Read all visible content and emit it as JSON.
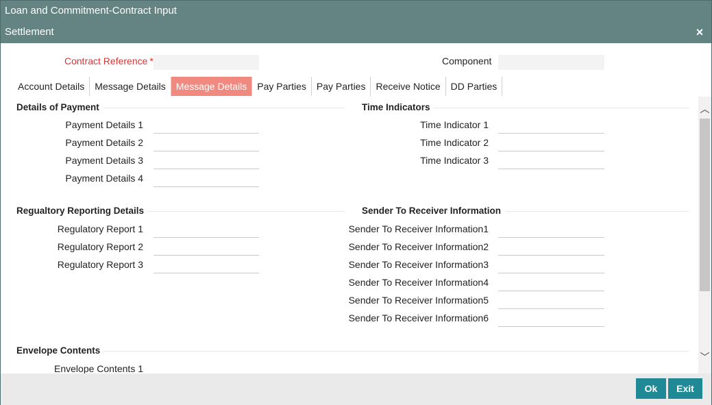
{
  "window": {
    "title": "Loan and Commitment-Contract Input",
    "subtitle": "Settlement",
    "close_icon": "×"
  },
  "header": {
    "contract_reference_label": "Contract Reference",
    "required_mark": "*",
    "contract_reference_value": "",
    "component_label": "Component",
    "component_value": ""
  },
  "tabs": [
    {
      "label": "Account Details",
      "active": false
    },
    {
      "label": "Message Details",
      "active": false
    },
    {
      "label": "Message Details",
      "active": true
    },
    {
      "label": "Pay Parties",
      "active": false
    },
    {
      "label": "Pay Parties",
      "active": false
    },
    {
      "label": "Receive Notice",
      "active": false
    },
    {
      "label": "DD Parties",
      "active": false
    }
  ],
  "sections": {
    "payment": {
      "title": "Details of Payment",
      "fields": [
        "Payment Details 1",
        "Payment Details 2",
        "Payment Details 3",
        "Payment Details 4"
      ]
    },
    "time": {
      "title": "Time Indicators",
      "fields": [
        "Time Indicator 1",
        "Time Indicator 2",
        "Time Indicator 3"
      ]
    },
    "regulatory": {
      "title": "Regualtory Reporting Details",
      "fields": [
        "Regulatory Report 1",
        "Regulatory Report 2",
        "Regulatory Report 3"
      ]
    },
    "sender": {
      "title": "Sender To Receiver Information",
      "fields": [
        "Sender To Receiver Information1",
        "Sender To Receiver Information2",
        "Sender To Receiver Information3",
        "Sender To Receiver Information4",
        "Sender To Receiver Information5",
        "Sender To Receiver Information6"
      ]
    },
    "envelope": {
      "title": "Envelope Contents",
      "fields": [
        "Envelope Contents 1"
      ]
    }
  },
  "scrollbar": {
    "up_icon": "chevron-up-icon",
    "down_icon": "chevron-down-icon",
    "up_glyph": "︿",
    "down_glyph": "﹀"
  },
  "buttons": {
    "ok": "Ok",
    "exit": "Exit"
  },
  "colors": {
    "titlebar": "#648484",
    "active_tab": "#f08a80",
    "required": "#e03030",
    "button": "#1f8a96"
  }
}
